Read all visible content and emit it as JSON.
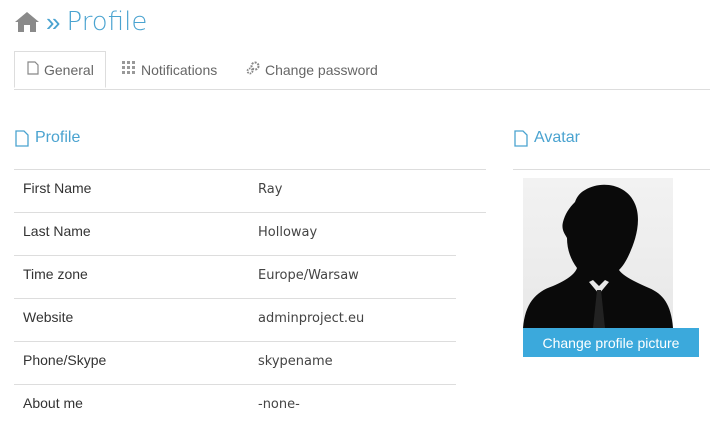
{
  "header": {
    "separator": "»",
    "title": "Profile"
  },
  "tabs": [
    {
      "label": "General",
      "icon": "document-icon",
      "active": true
    },
    {
      "label": "Notifications",
      "icon": "grid-icon",
      "active": false
    },
    {
      "label": "Change password",
      "icon": "gears-icon",
      "active": false
    }
  ],
  "profile_section": {
    "heading": "Profile",
    "rows": [
      {
        "label": "First Name",
        "value": "Ray"
      },
      {
        "label": "Last Name",
        "value": "Holloway"
      },
      {
        "label": "Time zone",
        "value": "Europe/Warsaw"
      },
      {
        "label": "Website",
        "value": "adminproject.eu"
      },
      {
        "label": "Phone/Skype",
        "value": "skypename"
      },
      {
        "label": "About me",
        "value": "-none-"
      }
    ]
  },
  "avatar_section": {
    "heading": "Avatar",
    "button_label": "Change profile picture"
  },
  "colors": {
    "accent": "#4aa3d0",
    "button": "#3ba9dc"
  }
}
